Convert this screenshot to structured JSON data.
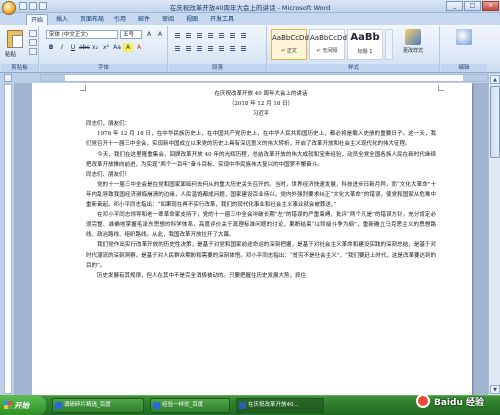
{
  "titlebar": {
    "title": "在庆祝改革开放40周年大会上的讲话 - Microsoft Word",
    "minimize": "_",
    "maximize": "□",
    "close": "×"
  },
  "tabs": [
    "开始",
    "插入",
    "页面布局",
    "引用",
    "邮件",
    "审阅",
    "视图",
    "开发工具"
  ],
  "ribbon": {
    "clipboard": {
      "paste": "粘贴",
      "label": "剪贴板"
    },
    "font": {
      "name": "宋体 (中文正文)",
      "size": "五号",
      "label": "字体",
      "row1": [
        "A",
        "A",
        "Aa",
        "A",
        "变"
      ],
      "row2": [
        "B",
        "I",
        "U",
        "abc",
        "x₂",
        "x²",
        "Aa",
        "A",
        "A"
      ]
    },
    "paragraph": {
      "label": "段落"
    },
    "styles": {
      "label": "样式",
      "items": [
        {
          "sample": "AaBbCcDd",
          "name": "↵ 正文"
        },
        {
          "sample": "AaBbCcDd",
          "name": "↵ 无间隔"
        },
        {
          "sample": "AaBb",
          "name": "标题 1"
        }
      ],
      "change": "更改样式"
    },
    "editing": {
      "label": "编辑"
    }
  },
  "document": {
    "title": "在庆祝改革开放 40 周年大会上的讲话",
    "date": "（2018 年 12 月 18 日）",
    "author": "习近平",
    "paragraphs": [
      "同志们，朋友们：",
      "　　1978 年 12 月 18 日，在中华民族历史上，在中国共产党历史上，在中华人民共和国历史上，都必将是载入史册的重要日子。这一天，我们党召开十一届三中全会，实现新中国成立以来党的历史上具有深远意义的伟大转折，开启了改革开放和社会主义现代化的伟大征程。",
      "　　今天，我们在这里隆重集会，回顾改革开放 40 年的光辉历程，总结改革开放的伟大成就和宝贵经验，动员全党全国各族人民在新时代继续把改革开放推向前进，为实现“两个一百年”奋斗目标、实现中华民族伟大复兴的中国梦不懈奋斗。",
      "同志们、朋友们！",
      "　　党的十一届三中全会是在党和国家面临何去何从的重大历史关头召开的。当时，世界经济快速发展，科技进步日新月异，而“文化大革命”十年内乱导致我国经济濒临崩溃的边缘，人民温饱都成问题，国家建设百业待兴。党内外强烈要求纠正“文化大革命”的错误，使党和国家从危难中重新奋起。邓小平同志指出：“如果现在再不实行改革，我们的现代化事业和社会主义事业就会被葬送。”",
      "　　在邓小平同志领导和老一辈革命家支持下，党的十一届三中全会冲破长期“左”的错误的严重束缚，批评“两个凡是”的错误方针，充分肯定必须完整、准确地掌握毛泽东思想的科学体系，高度评价关于真理标准问题的讨论，果断结束“以阶级斗争为纲”，重新确立马克思主义的思想路线、政治路线、组织路线。从此，我国改革开放拉开了大幕。",
      "　　我们党作出实行改革开放的历史性决策，是基于对党和国家前途命运的深刻把握，是基于对社会主义革命和建设实践的深刻总结，是基于对时代潮流的深刻洞察，是基于对人民群众期盼和需要的深刻体悟。邓小平同志指出：“贫穷不是社会主义”，“我们要赶上时代，这是改革要达到的目的”。",
      "　　历史发展有其规律，但人在其中不是完全消极被动的。只要把握住历史发展大势，抓住"
    ]
  },
  "scrollbar": {
    "up": "▲",
    "down": "▼"
  },
  "taskbar": {
    "start": "开始",
    "tasks": [
      "调研碎片精选_百度",
      "经验一样优_百度",
      "在庆祝改革开放40..."
    ],
    "watermark": "Baidu 经验"
  }
}
